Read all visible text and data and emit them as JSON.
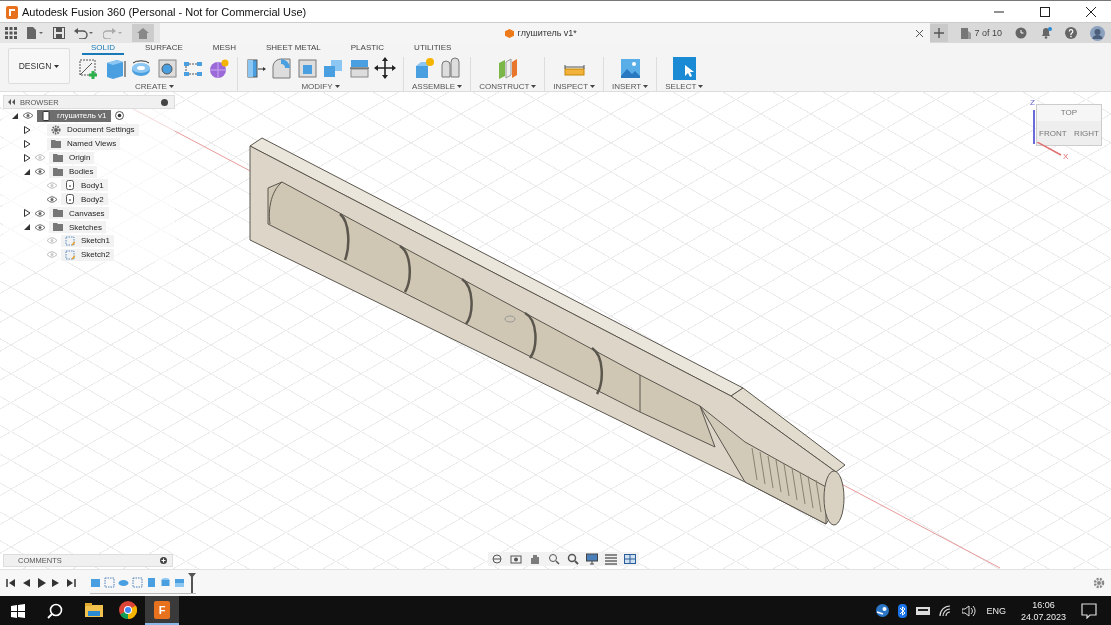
{
  "window": {
    "title": "Autodesk Fusion 360 (Personal - Not for Commercial Use)"
  },
  "document_tab": {
    "title": "глушитель v1*"
  },
  "quick_bar": {
    "counter": "7 of 10"
  },
  "workspace": {
    "label": "DESIGN"
  },
  "ribbon_tabs": [
    {
      "label": "SOLID",
      "selected": true
    },
    {
      "label": "SURFACE",
      "selected": false
    },
    {
      "label": "MESH",
      "selected": false
    },
    {
      "label": "SHEET METAL",
      "selected": false
    },
    {
      "label": "PLASTIC",
      "selected": false
    },
    {
      "label": "UTILITIES",
      "selected": false
    }
  ],
  "ribbon_groups": [
    {
      "label": "CREATE"
    },
    {
      "label": "MODIFY"
    },
    {
      "label": "ASSEMBLE"
    },
    {
      "label": "CONSTRUCT"
    },
    {
      "label": "INSPECT"
    },
    {
      "label": "INSERT"
    },
    {
      "label": "SELECT"
    }
  ],
  "browser": {
    "title": "BROWSER",
    "tree": [
      {
        "label": "глушитель v1",
        "kind": "component",
        "visible": true,
        "expanded": true,
        "selected": true,
        "children": [
          {
            "label": "Document Settings",
            "kind": "settings",
            "expanded": false,
            "selected": false
          },
          {
            "label": "Named Views",
            "kind": "folder",
            "expanded": false,
            "selected": false
          },
          {
            "label": "Origin",
            "kind": "folder",
            "visible": false,
            "expanded": false,
            "selected": false
          },
          {
            "label": "Bodies",
            "kind": "folder",
            "visible": true,
            "expanded": true,
            "selected": false,
            "children": [
              {
                "label": "Body1",
                "kind": "body",
                "visible": false,
                "selected": false
              },
              {
                "label": "Body2",
                "kind": "body",
                "visible": true,
                "selected": false
              }
            ]
          },
          {
            "label": "Canvases",
            "kind": "folder",
            "visible": true,
            "expanded": false,
            "selected": false
          },
          {
            "label": "Sketches",
            "kind": "folder",
            "visible": true,
            "expanded": true,
            "selected": false,
            "children": [
              {
                "label": "Sketch1",
                "kind": "sketch",
                "visible": false,
                "selected": false
              },
              {
                "label": "Sketch2",
                "kind": "sketch",
                "visible": false,
                "selected": false
              }
            ]
          }
        ]
      }
    ]
  },
  "viewcube": {
    "top": "TOP",
    "front": "FRONT",
    "right": "RIGHT",
    "z_axis": "Z",
    "x_axis": "X"
  },
  "comments": {
    "title": "COMMENTS"
  },
  "taskbar": {
    "apps": [
      {
        "kind": "explorer",
        "active": false
      },
      {
        "kind": "chrome",
        "active": false
      },
      {
        "kind": "fusion",
        "active": true,
        "badge": "F"
      }
    ],
    "language": "ENG",
    "time": "16:06",
    "date": "24.07.2023"
  }
}
